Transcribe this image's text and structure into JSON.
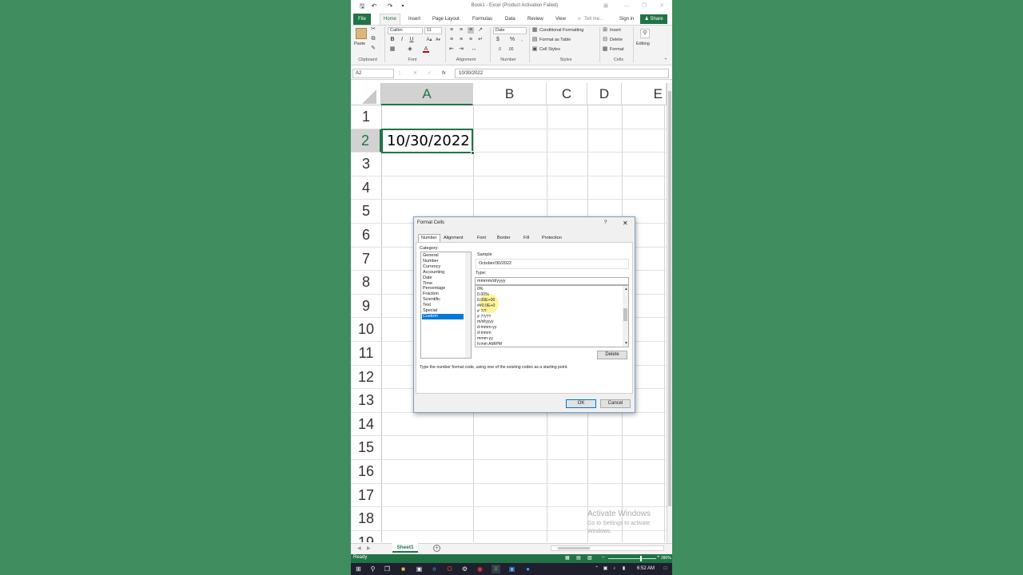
{
  "window": {
    "title": "Book1 - Excel (Product Activation Failed)"
  },
  "ribbon": {
    "tabs": [
      "File",
      "Home",
      "Insert",
      "Page Layout",
      "Formulas",
      "Data",
      "Review",
      "View"
    ],
    "tell_me": "Tell me...",
    "sign_in": "Sign in",
    "share": "Share",
    "font_name": "Calibri",
    "font_size": "11",
    "number_format": "Date",
    "paste": "Paste",
    "conditional_formatting": "Conditional Formatting",
    "format_as_table": "Format as Table",
    "cell_styles": "Cell Styles",
    "insert": "Insert",
    "delete": "Delete",
    "format": "Format",
    "editing": "Editing",
    "groups": [
      "Clipboard",
      "Font",
      "Alignment",
      "Number",
      "Styles",
      "Cells"
    ]
  },
  "formula_bar": {
    "name_box": "A2",
    "fx": "fx",
    "value": "10/30/2022"
  },
  "grid": {
    "columns": [
      "A",
      "B",
      "C",
      "D",
      "E"
    ],
    "rows": [
      "1",
      "2",
      "3",
      "4",
      "5",
      "6",
      "7",
      "8",
      "9",
      "10",
      "11",
      "12",
      "13",
      "14",
      "15",
      "16",
      "17",
      "18",
      "19"
    ],
    "a2_value": "10/30/2022"
  },
  "dialog": {
    "title": "Format Cells",
    "help": "?",
    "tabs": [
      "Number",
      "Alignment",
      "Font",
      "Border",
      "Fill",
      "Protection"
    ],
    "category_label": "Category:",
    "categories": [
      "General",
      "Number",
      "Currency",
      "Accounting",
      "Date",
      "Time",
      "Percentage",
      "Fraction",
      "Scientific",
      "Text",
      "Special",
      "Custom"
    ],
    "selected_category": "Custom",
    "sample_label": "Sample",
    "sample_value": "October/30/2022",
    "type_label": "Type:",
    "type_value": "mmmm/d/yyyy",
    "type_list": [
      "0%",
      "0.00%",
      "0.00E+00",
      "##0.0E+0",
      "# ?/?",
      "# ??/??",
      "m/d/yyyy",
      "d-mmm-yy",
      "d-mmm",
      "mmm-yy",
      "h:mm AM/PM"
    ],
    "delete_button": "Delete",
    "hint": "Type the number format code, using one of the existing codes as a starting point.",
    "ok": "OK",
    "cancel": "Cancel"
  },
  "sheet_tab": "Sheet1",
  "status": {
    "ready": "Ready",
    "zoom": "280%"
  },
  "watermark": {
    "line1": "Activate Windows",
    "line2": "Go to Settings to activate",
    "line3": "Windows."
  },
  "taskbar": {
    "time": "6:52 AM"
  }
}
